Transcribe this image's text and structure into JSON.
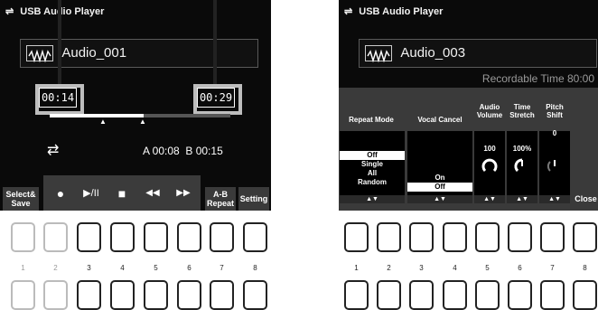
{
  "left": {
    "title": "USB Audio Player",
    "song": "Audio_001",
    "time_current": "00:14",
    "time_total": "00:29",
    "ab_times": "A 00:08  B 00:15",
    "fkeys": {
      "select_save": "Select&\nSave",
      "ab_repeat": "A-B\nRepeat",
      "setting": "Setting"
    },
    "transport": {
      "record": "●",
      "play_pause": "▶/II",
      "stop": "■",
      "prev": "◀◀",
      "next": "▶▶"
    }
  },
  "right": {
    "title": "USB Audio Player",
    "song": "Audio_003",
    "recordable": "Recordable Time 80:00",
    "columns": {
      "repeat_mode": "Repeat Mode",
      "vocal_cancel": "Vocal Cancel",
      "audio_volume": "Audio\nVolume",
      "time_stretch": "Time\nStretch",
      "pitch_shift": "Pitch\nShift"
    },
    "repeat_options": [
      "Off",
      "Single",
      "All",
      "Random"
    ],
    "repeat_selected": "Off",
    "vocal_options": [
      "On",
      "Off"
    ],
    "vocal_selected": "Off",
    "volume_value": "100",
    "stretch_value": "100%",
    "pitch_value": "0",
    "close": "Close",
    "arrow": "▲▼"
  },
  "buttons": {
    "left_numbers": [
      "1",
      "2",
      "3",
      "4",
      "5",
      "6",
      "7",
      "8"
    ],
    "right_numbers": [
      "1",
      "2",
      "3",
      "4",
      "5",
      "6",
      "7",
      "8"
    ]
  }
}
